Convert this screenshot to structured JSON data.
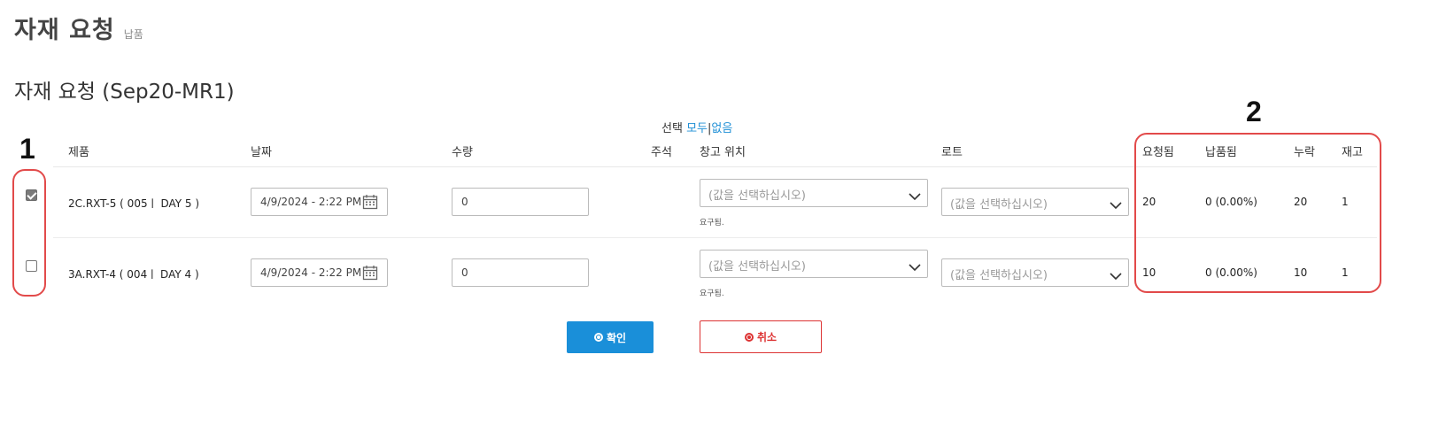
{
  "page": {
    "title": "자재 요청",
    "subtitle": "납품"
  },
  "section_title": "자재 요청 (Sep20-MR1)",
  "select_all": {
    "label": "선택",
    "all": "모두",
    "separator": "|",
    "none": "없음"
  },
  "annotations": {
    "one": "1",
    "two": "2"
  },
  "columns": {
    "product": "제품",
    "date": "날짜",
    "quantity": "수량",
    "note": "주석",
    "warehouse": "창고 위치",
    "lot": "로트",
    "requested": "요청됨",
    "delivered": "납품됨",
    "missing": "누락",
    "stock": "재고"
  },
  "rows": [
    {
      "checked": true,
      "product": "2C.RXT-5 ( 005ㅣ DAY 5 )",
      "date": "4/9/2024 - 2:22 PM",
      "quantity": "0",
      "warehouse_placeholder": "(값을 선택하십시오)",
      "warehouse_hint": "요구됨.",
      "lot_placeholder": "(값을 선택하십시오)",
      "requested": "20",
      "delivered": "0 (0.00%)",
      "missing": "20",
      "stock": "1"
    },
    {
      "checked": false,
      "product": "3A.RXT-4 ( 004ㅣ DAY 4 )",
      "date": "4/9/2024 - 2:22 PM",
      "quantity": "0",
      "warehouse_placeholder": "(값을 선택하십시오)",
      "warehouse_hint": "요구됨.",
      "lot_placeholder": "(값을 선택하십시오)",
      "requested": "10",
      "delivered": "0 (0.00%)",
      "missing": "10",
      "stock": "1"
    }
  ],
  "buttons": {
    "confirm": "확인",
    "cancel": "취소"
  },
  "colors": {
    "primary": "#1a8fd9",
    "danger": "#dd3333",
    "annotation": "#e24a4a"
  }
}
